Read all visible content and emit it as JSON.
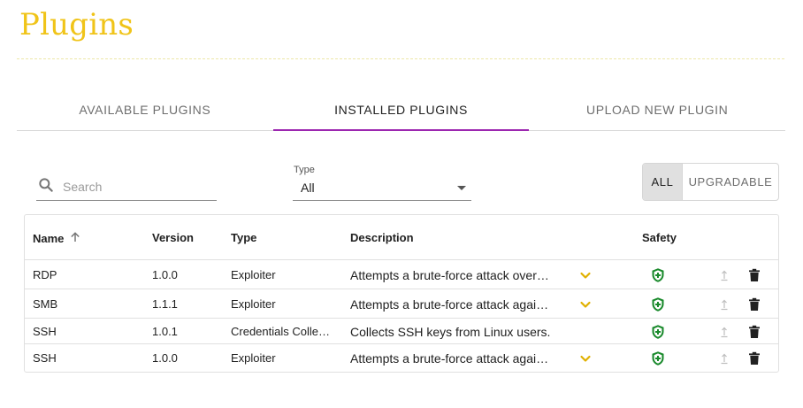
{
  "page": {
    "title": "Plugins"
  },
  "tabs": [
    {
      "label": "AVAILABLE PLUGINS",
      "active": false
    },
    {
      "label": "INSTALLED PLUGINS",
      "active": true
    },
    {
      "label": "UPLOAD NEW PLUGIN",
      "active": false
    }
  ],
  "filters": {
    "search_placeholder": "Search",
    "search_value": "",
    "type_label": "Type",
    "type_value": "All",
    "toggle_all": "ALL",
    "toggle_upgradable": "UPGRADABLE",
    "selected_toggle": "ALL"
  },
  "table": {
    "columns": {
      "name": "Name",
      "version": "Version",
      "type": "Type",
      "description": "Description",
      "safety": "Safety"
    },
    "sort": {
      "column": "Name",
      "direction": "ascending"
    },
    "rows": [
      {
        "name": "RDP",
        "version": "1.0.0",
        "type": "Exploiter",
        "description": "Attempts a brute-force attack over…",
        "expandable": true,
        "safe": true
      },
      {
        "name": "SMB",
        "version": "1.1.1",
        "type": "Exploiter",
        "description": "Attempts a brute-force attack agai…",
        "expandable": true,
        "safe": true
      },
      {
        "name": "SSH",
        "version": "1.0.1",
        "type": "Credentials Colle…",
        "description": "Collects SSH keys from Linux users.",
        "expandable": false,
        "safe": true
      },
      {
        "name": "SSH",
        "version": "1.0.0",
        "type": "Exploiter",
        "description": "Attempts a brute-force attack agai…",
        "expandable": true,
        "safe": true
      }
    ]
  },
  "icons": {
    "search": "search-icon",
    "sort": "arrow-up-icon",
    "expand": "chevron-down-icon",
    "safety": "shield-plus-icon",
    "upgrade": "upgrade-arrow-icon",
    "delete": "trash-icon"
  },
  "colors": {
    "title": "#f0c419",
    "active_tab_indicator": "#9c27b0",
    "safety_shield": "#1a8a2c",
    "expand_chevron": "#e0b000",
    "delete_icon": "#212121",
    "upgrade_disabled": "#bdbdbd"
  }
}
